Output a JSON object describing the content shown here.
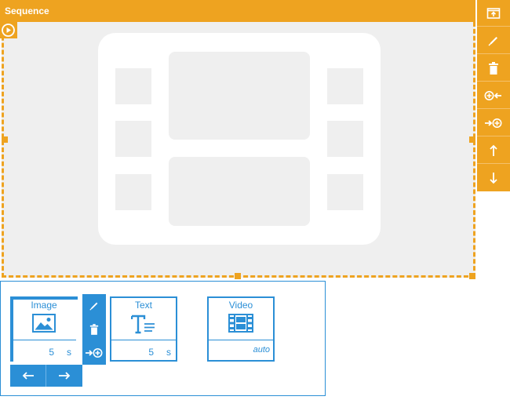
{
  "sequence": {
    "title": "Sequence"
  },
  "sidebar": {
    "buttons": [
      "exit-icon",
      "edit-icon",
      "delete-icon",
      "insert-before-icon",
      "insert-after-icon",
      "move-up-icon",
      "move-down-icon"
    ]
  },
  "cards": [
    {
      "title": "Image",
      "icon": "image-icon",
      "duration": "5",
      "unit": "s"
    },
    {
      "title": "Text",
      "icon": "text-icon",
      "duration": "5",
      "unit": "s"
    },
    {
      "title": "Video",
      "icon": "film-icon",
      "auto": "auto"
    }
  ],
  "colors": {
    "accent": "#EEA320",
    "blue": "#2b8fd6",
    "canvas": "#EFEFEF"
  }
}
